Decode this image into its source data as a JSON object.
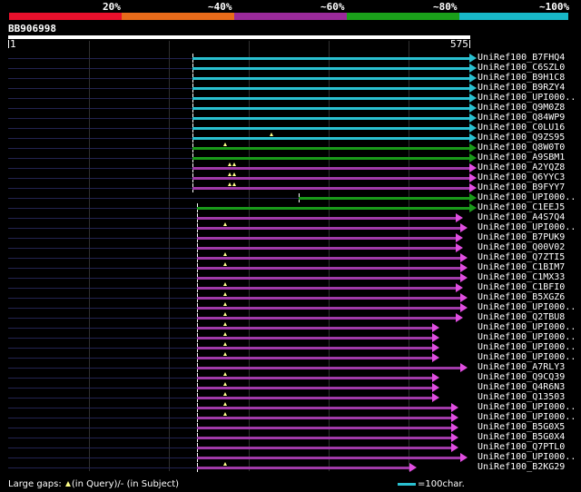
{
  "legend": {
    "labels": [
      "20%",
      "~40%",
      "~60%",
      "~80%",
      "~100%"
    ],
    "colors": [
      "#e8102c",
      "#e86b1a",
      "#9a2a9a",
      "#1aa01a",
      "#18b8c8"
    ]
  },
  "query": {
    "id": "BB906998",
    "start": "1",
    "end": "575"
  },
  "colors": {
    "cyan": "#2ac0d0",
    "green": "#1a9a1a",
    "purple": "#a03aa8",
    "gap_marker": "#ffff88",
    "outline": "#e04de0"
  },
  "hits": [
    {
      "label": "UniRef100_B7FHQ4",
      "color": "cyan",
      "start": 0.4,
      "end": 1.0,
      "gaps": []
    },
    {
      "label": "UniRef100_C6SZL0",
      "color": "cyan",
      "start": 0.4,
      "end": 1.0,
      "gaps": []
    },
    {
      "label": "UniRef100_B9H1C8",
      "color": "cyan",
      "start": 0.4,
      "end": 1.0,
      "gaps": []
    },
    {
      "label": "UniRef100_B9RZY4",
      "color": "cyan",
      "start": 0.4,
      "end": 1.0,
      "gaps": []
    },
    {
      "label": "UniRef100_UPI000..",
      "color": "cyan",
      "start": 0.4,
      "end": 1.0,
      "gaps": []
    },
    {
      "label": "UniRef100_Q9M0Z8",
      "color": "cyan",
      "start": 0.4,
      "end": 1.0,
      "gaps": []
    },
    {
      "label": "UniRef100_Q84WP9",
      "color": "cyan",
      "start": 0.4,
      "end": 1.0,
      "gaps": []
    },
    {
      "label": "UniRef100_C0LU16",
      "color": "cyan",
      "start": 0.4,
      "end": 1.0,
      "gaps": []
    },
    {
      "label": "UniRef100_Q9ZS95",
      "color": "cyan",
      "start": 0.4,
      "end": 1.0,
      "gaps": [
        0.57
      ]
    },
    {
      "label": "UniRef100_Q8W0T0",
      "color": "green",
      "start": 0.4,
      "end": 1.0,
      "gaps": [
        0.47
      ]
    },
    {
      "label": "UniRef100_A9SBM1",
      "color": "green",
      "start": 0.4,
      "end": 1.0,
      "gaps": []
    },
    {
      "label": "UniRef100_A2YQZ8",
      "color": "purple",
      "start": 0.4,
      "end": 1.0,
      "gaps": [
        0.48,
        0.49
      ]
    },
    {
      "label": "UniRef100_Q6YYC3",
      "color": "purple",
      "start": 0.4,
      "end": 1.0,
      "gaps": [
        0.48,
        0.49
      ]
    },
    {
      "label": "UniRef100_B9FYY7",
      "color": "purple",
      "start": 0.4,
      "end": 1.0,
      "gaps": [
        0.48,
        0.49
      ]
    },
    {
      "label": "UniRef100_UPI000..",
      "color": "green",
      "start": 0.63,
      "end": 1.0,
      "gaps": []
    },
    {
      "label": "UniRef100_C1EEJ5",
      "color": "green",
      "start": 0.41,
      "end": 1.0,
      "gaps": []
    },
    {
      "label": "UniRef100_A4S7Q4",
      "color": "purple",
      "start": 0.41,
      "end": 0.97,
      "gaps": []
    },
    {
      "label": "UniRef100_UPI000..",
      "color": "purple",
      "start": 0.41,
      "end": 0.98,
      "gaps": [
        0.47
      ]
    },
    {
      "label": "UniRef100_B7PUK9",
      "color": "purple",
      "start": 0.41,
      "end": 0.97,
      "gaps": []
    },
    {
      "label": "UniRef100_Q00V02",
      "color": "purple",
      "start": 0.41,
      "end": 0.97,
      "gaps": []
    },
    {
      "label": "UniRef100_Q7ZTI5",
      "color": "purple",
      "start": 0.41,
      "end": 0.98,
      "gaps": [
        0.47
      ]
    },
    {
      "label": "UniRef100_C1BIM7",
      "color": "purple",
      "start": 0.41,
      "end": 0.98,
      "gaps": [
        0.47
      ]
    },
    {
      "label": "UniRef100_C1MX33",
      "color": "purple",
      "start": 0.41,
      "end": 0.98,
      "gaps": []
    },
    {
      "label": "UniRef100_C1BFI0",
      "color": "purple",
      "start": 0.41,
      "end": 0.97,
      "gaps": [
        0.47
      ]
    },
    {
      "label": "UniRef100_B5XGZ6",
      "color": "purple",
      "start": 0.41,
      "end": 0.98,
      "gaps": [
        0.47
      ]
    },
    {
      "label": "UniRef100_UPI000..",
      "color": "purple",
      "start": 0.41,
      "end": 0.98,
      "gaps": [
        0.47
      ]
    },
    {
      "label": "UniRef100_Q2TBU8",
      "color": "purple",
      "start": 0.41,
      "end": 0.97,
      "gaps": [
        0.47
      ]
    },
    {
      "label": "UniRef100_UPI000..",
      "color": "purple",
      "start": 0.41,
      "end": 0.92,
      "gaps": [
        0.47
      ]
    },
    {
      "label": "UniRef100_UPI000..",
      "color": "purple",
      "start": 0.41,
      "end": 0.92,
      "gaps": [
        0.47
      ]
    },
    {
      "label": "UniRef100_UPI000..",
      "color": "purple",
      "start": 0.41,
      "end": 0.92,
      "gaps": [
        0.47
      ]
    },
    {
      "label": "UniRef100_UPI000..",
      "color": "purple",
      "start": 0.41,
      "end": 0.92,
      "gaps": [
        0.47
      ]
    },
    {
      "label": "UniRef100_A7RLY3",
      "color": "purple",
      "start": 0.41,
      "end": 0.98,
      "gaps": []
    },
    {
      "label": "UniRef100_Q9CQ39",
      "color": "purple",
      "start": 0.41,
      "end": 0.92,
      "gaps": [
        0.47
      ]
    },
    {
      "label": "UniRef100_Q4R6N3",
      "color": "purple",
      "start": 0.41,
      "end": 0.92,
      "gaps": [
        0.47
      ]
    },
    {
      "label": "UniRef100_Q13503",
      "color": "purple",
      "start": 0.41,
      "end": 0.92,
      "gaps": [
        0.47
      ]
    },
    {
      "label": "UniRef100_UPI000..",
      "color": "purple",
      "start": 0.41,
      "end": 0.96,
      "gaps": [
        0.47
      ]
    },
    {
      "label": "UniRef100_UPI000..",
      "color": "purple",
      "start": 0.41,
      "end": 0.96,
      "gaps": [
        0.47
      ]
    },
    {
      "label": "UniRef100_B5G0X5",
      "color": "purple",
      "start": 0.41,
      "end": 0.96,
      "gaps": []
    },
    {
      "label": "UniRef100_B5G0X4",
      "color": "purple",
      "start": 0.41,
      "end": 0.96,
      "gaps": []
    },
    {
      "label": "UniRef100_Q7PTL0",
      "color": "purple",
      "start": 0.41,
      "end": 0.96,
      "gaps": []
    },
    {
      "label": "UniRef100_UPI000..",
      "color": "purple",
      "start": 0.41,
      "end": 0.98,
      "gaps": []
    },
    {
      "label": "UniRef100_B2KG29",
      "color": "purple",
      "start": 0.41,
      "end": 0.87,
      "gaps": [
        0.47
      ]
    }
  ],
  "footer": {
    "prefix": "Large gaps:",
    "in_query": "(in Query)/",
    "dash": "-",
    "in_subject": "(in Subject)",
    "scale_text": "=100char."
  }
}
